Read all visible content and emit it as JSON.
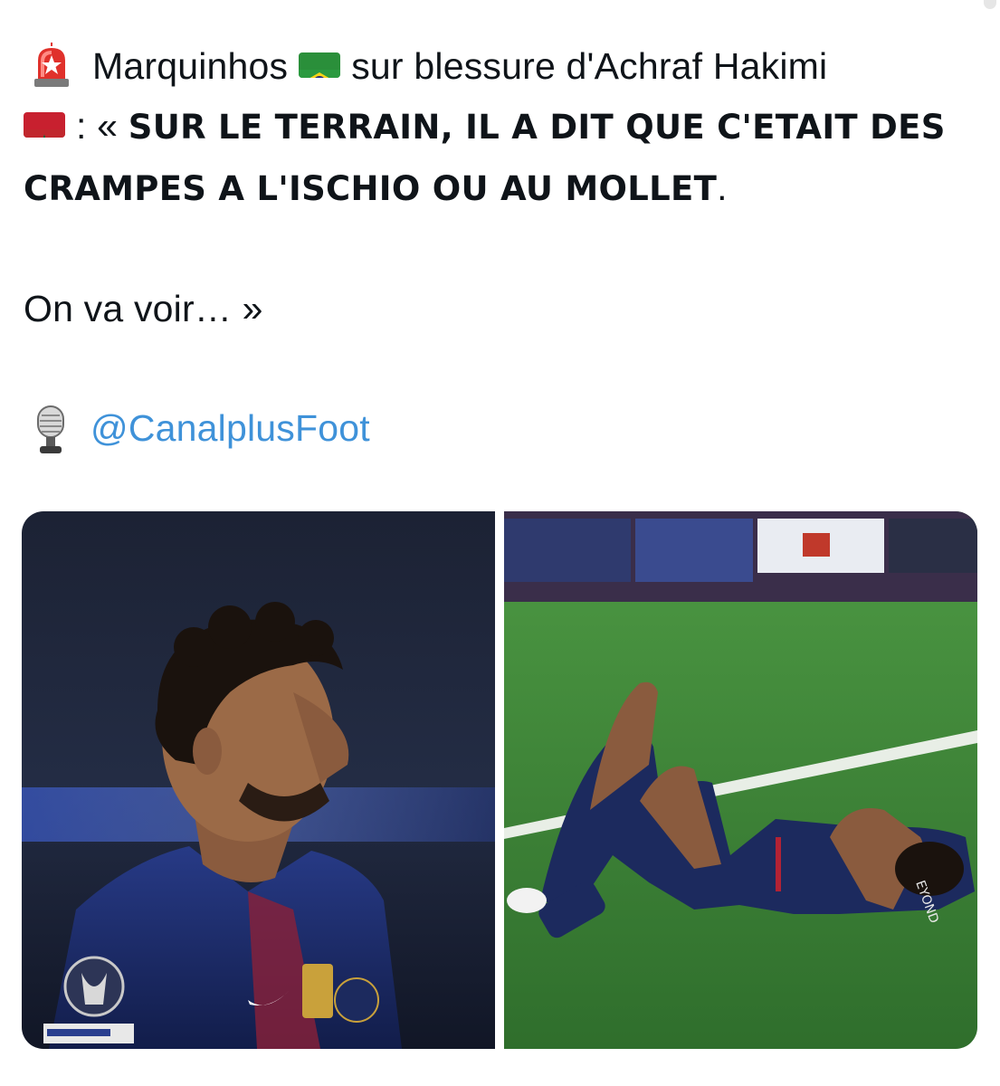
{
  "tweet": {
    "line1": {
      "siren_icon": "police-siren-emoji",
      "name": "Marquinhos",
      "flag1": "brazil-flag-emoji",
      "text": "sur blessure d'Achraf Hakimi"
    },
    "line2": {
      "flag2": "morocco-flag-emoji",
      "prefix": ": « ",
      "bold": "SUR LE TERRAIN, IL A DIT QUE C'ETAIT DES"
    },
    "line3": {
      "bold": "CRAMPES A L'ISCHIO OU AU MOLLET",
      "suffix": "."
    },
    "line4": "On va voir… »",
    "source": {
      "mic_icon": "studio-microphone-emoji",
      "handle": "@CanalplusFoot"
    }
  },
  "media": {
    "count": 2,
    "colors": {
      "jersey": "#1c2a5e",
      "pitch": "#3f8a3a",
      "background_dark": "#1a2235",
      "handle_link": "#3f92d9"
    }
  }
}
